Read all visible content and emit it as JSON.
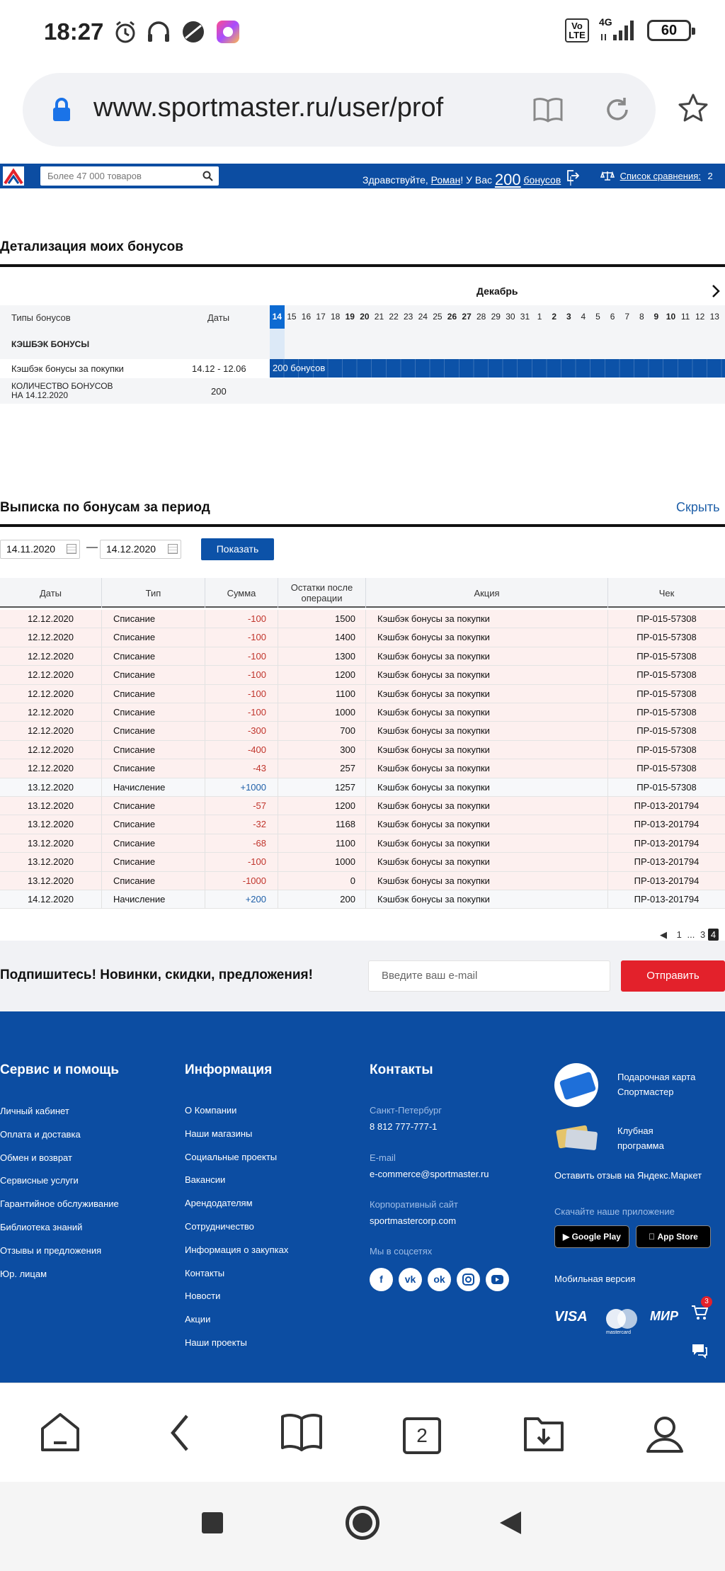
{
  "status_bar": {
    "time": "18:27",
    "network": "4G",
    "volte": "Vo LTE",
    "battery": "60",
    "icons": [
      "alarm-icon",
      "headphones-icon",
      "app-circle-icon",
      "app-square-icon",
      "signal-icon",
      "battery-icon"
    ]
  },
  "browser": {
    "url": "www.sportmaster.ru/user/prof",
    "tab_count": "2",
    "bottom_icons": [
      "home-icon",
      "back-icon",
      "bookmarks-icon",
      "tabs-icon",
      "downloads-icon",
      "profile-icon"
    ]
  },
  "site_header": {
    "search_placeholder": "Более 47 000 товаров",
    "greeting_prefix": "Здравствуйте,",
    "user_name": "Роман",
    "greeting_mid": "! У Вас",
    "bonus_count": "200",
    "bonus_word": "бонусов",
    "compare_label": "Список сравнения:",
    "compare_count": "2"
  },
  "bonus_details": {
    "title": "Детализация моих бонусов",
    "month": "Декабрь",
    "col_types": "Типы бонусов",
    "col_dates": "Даты",
    "days": [
      "14",
      "15",
      "16",
      "17",
      "18",
      "19",
      "20",
      "21",
      "22",
      "23",
      "24",
      "25",
      "26",
      "27",
      "28",
      "29",
      "30",
      "31",
      "1",
      "2",
      "3",
      "4",
      "5",
      "6",
      "7",
      "8",
      "9",
      "10",
      "11",
      "12",
      "13"
    ],
    "bold_days": [
      "19",
      "20",
      "26",
      "27",
      "2",
      "3",
      "9",
      "10"
    ],
    "selected_day": "14",
    "group_title": "КЭШБЭК БОНУСЫ",
    "row_label": "Кэшбэк бонусы за покупки",
    "row_dates": "14.12 - 12.06",
    "bar_label": "200 бонусов",
    "total_label_1": "КОЛИЧЕСТВО БОНУСОВ",
    "total_label_2": "НА 14.12.2020",
    "total_value": "200"
  },
  "statement": {
    "title": "Выписка по бонусам за период",
    "hide_link": "Скрыть",
    "date_from": "14.11.2020",
    "date_to": "14.12.2020",
    "date_sep": "—",
    "show_button": "Показать",
    "columns": [
      "Даты",
      "Тип",
      "Сумма",
      "Остатки после операции",
      "Акция",
      "Чек"
    ],
    "rows": [
      {
        "date": "12.12.2020",
        "type": "Списание",
        "amount": "-100",
        "balance": "1500",
        "promo": "Кэшбэк бонусы за покупки",
        "check": "ПР-015-57308"
      },
      {
        "date": "12.12.2020",
        "type": "Списание",
        "amount": "-100",
        "balance": "1400",
        "promo": "Кэшбэк бонусы за покупки",
        "check": "ПР-015-57308"
      },
      {
        "date": "12.12.2020",
        "type": "Списание",
        "amount": "-100",
        "balance": "1300",
        "promo": "Кэшбэк бонусы за покупки",
        "check": "ПР-015-57308"
      },
      {
        "date": "12.12.2020",
        "type": "Списание",
        "amount": "-100",
        "balance": "1200",
        "promo": "Кэшбэк бонусы за покупки",
        "check": "ПР-015-57308"
      },
      {
        "date": "12.12.2020",
        "type": "Списание",
        "amount": "-100",
        "balance": "1100",
        "promo": "Кэшбэк бонусы за покупки",
        "check": "ПР-015-57308"
      },
      {
        "date": "12.12.2020",
        "type": "Списание",
        "amount": "-100",
        "balance": "1000",
        "promo": "Кэшбэк бонусы за покупки",
        "check": "ПР-015-57308"
      },
      {
        "date": "12.12.2020",
        "type": "Списание",
        "amount": "-300",
        "balance": "700",
        "promo": "Кэшбэк бонусы за покупки",
        "check": "ПР-015-57308"
      },
      {
        "date": "12.12.2020",
        "type": "Списание",
        "amount": "-400",
        "balance": "300",
        "promo": "Кэшбэк бонусы за покупки",
        "check": "ПР-015-57308"
      },
      {
        "date": "12.12.2020",
        "type": "Списание",
        "amount": "-43",
        "balance": "257",
        "promo": "Кэшбэк бонусы за покупки",
        "check": "ПР-015-57308"
      },
      {
        "date": "13.12.2020",
        "type": "Начисление",
        "amount": "+1000",
        "balance": "1257",
        "promo": "Кэшбэк бонусы за покупки",
        "check": "ПР-015-57308"
      },
      {
        "date": "13.12.2020",
        "type": "Списание",
        "amount": "-57",
        "balance": "1200",
        "promo": "Кэшбэк бонусы за покупки",
        "check": "ПР-013-201794"
      },
      {
        "date": "13.12.2020",
        "type": "Списание",
        "amount": "-32",
        "balance": "1168",
        "promo": "Кэшбэк бонусы за покупки",
        "check": "ПР-013-201794"
      },
      {
        "date": "13.12.2020",
        "type": "Списание",
        "amount": "-68",
        "balance": "1100",
        "promo": "Кэшбэк бонусы за покупки",
        "check": "ПР-013-201794"
      },
      {
        "date": "13.12.2020",
        "type": "Списание",
        "amount": "-100",
        "balance": "1000",
        "promo": "Кэшбэк бонусы за покупки",
        "check": "ПР-013-201794"
      },
      {
        "date": "13.12.2020",
        "type": "Списание",
        "amount": "-1000",
        "balance": "0",
        "promo": "Кэшбэк бонусы за покупки",
        "check": "ПР-013-201794"
      },
      {
        "date": "14.12.2020",
        "type": "Начисление",
        "amount": "+200",
        "balance": "200",
        "promo": "Кэшбэк бонусы за покупки",
        "check": "ПР-013-201794"
      }
    ],
    "pagination": {
      "first": "1",
      "ellipsis": "...",
      "prev_last": "3",
      "current": "4"
    }
  },
  "subscribe": {
    "text": "Подпишитесь! Новинки, скидки, предложения!",
    "placeholder": "Введите ваш e-mail",
    "button": "Отправить"
  },
  "footer": {
    "service_title": "Сервис и помощь",
    "service_links": [
      "Личный кабинет",
      "Оплата и доставка",
      "Обмен и возврат",
      "Сервисные услуги",
      "Гарантийное обслуживание",
      "Библиотека знаний",
      "Отзывы и предложения",
      "Юр. лицам"
    ],
    "info_title": "Информация",
    "info_links": [
      "О Компании",
      "Наши магазины",
      "Социальные проекты",
      "Вакансии",
      "Арендодателям",
      "Сотрудничество",
      "Информация о закупках",
      "Контакты",
      "Новости",
      "Акции",
      "Наши проекты"
    ],
    "contacts_title": "Контакты",
    "city": "Санкт-Петербург",
    "phone": "8 812 777-777-1",
    "email_label": "E-mail",
    "email": "e-commerce@sportmaster.ru",
    "corp_label": "Корпоративный сайт",
    "corp_site": "sportmastercorp.com",
    "social_label": "Мы в соцсетях",
    "gift_card": [
      "Подарочная карта",
      "Спортмастер"
    ],
    "club": [
      "Клубная",
      "программа"
    ],
    "yandex_review": "Оставить отзыв на Яндекс.Маркет",
    "download_label": "Скачайте наше приложение",
    "google_play": "Google Play",
    "app_store": "App Store",
    "mobile_version": "Мобильная версия",
    "payments": [
      "VISA",
      "mastercard",
      "МИР"
    ],
    "cart_count": "3"
  }
}
